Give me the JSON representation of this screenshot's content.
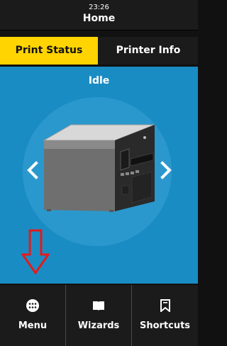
{
  "header": {
    "time": "23:26",
    "title": "Home"
  },
  "tabs": [
    {
      "label": "Print Status",
      "active": true
    },
    {
      "label": "Printer Info",
      "active": false
    }
  ],
  "main": {
    "status": "Idle"
  },
  "bottom_bar": [
    {
      "label": "Menu",
      "icon": "menu-grid-icon"
    },
    {
      "label": "Wizards",
      "icon": "book-icon"
    },
    {
      "label": "Shortcuts",
      "icon": "bookmark-icon"
    }
  ],
  "colors": {
    "accent_tab": "#ffd400",
    "content_bg": "#1a8cc4",
    "bar_bg": "#1b1b1b",
    "annotation_arrow": "#e21b1b"
  }
}
